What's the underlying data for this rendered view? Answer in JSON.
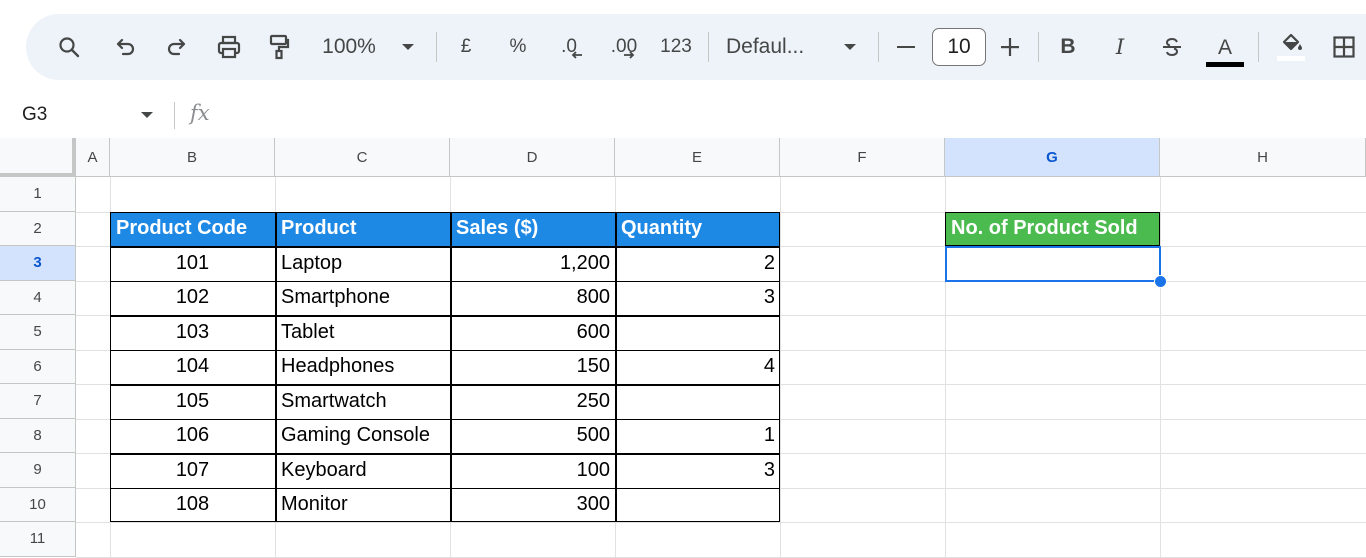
{
  "toolbar": {
    "zoom": "100%",
    "currency": "£",
    "percent": "%",
    "format_123": "123",
    "font": "Defaul...",
    "font_size": "10",
    "decrease_decimal": ".0",
    "increase_decimal": ".00",
    "bold": "B",
    "italic": "I",
    "text_color_letter": "A"
  },
  "formula_bar": {
    "name_box": "G3",
    "fx_label": "fx",
    "formula_value": ""
  },
  "columns": [
    "A",
    "B",
    "C",
    "D",
    "E",
    "F",
    "G",
    "H"
  ],
  "rows": [
    "1",
    "2",
    "3",
    "4",
    "5",
    "6",
    "7",
    "8",
    "9",
    "10",
    "11"
  ],
  "selected_cell": {
    "column": "G",
    "row": "3"
  },
  "table": {
    "headers": [
      "Product Code",
      "Product",
      "Sales ($)",
      "Quantity"
    ],
    "rows": [
      [
        "101",
        "Laptop",
        "1,200",
        "2"
      ],
      [
        "102",
        "Smartphone",
        "800",
        "3"
      ],
      [
        "103",
        "Tablet",
        "600",
        ""
      ],
      [
        "104",
        "Headphones",
        "150",
        "4"
      ],
      [
        "105",
        "Smartwatch",
        "250",
        ""
      ],
      [
        "106",
        "Gaming Console",
        "500",
        "1"
      ],
      [
        "107",
        "Keyboard",
        "100",
        "3"
      ],
      [
        "108",
        "Monitor",
        "300",
        ""
      ]
    ]
  },
  "result": {
    "header": "No. of Product Sold",
    "value": ""
  },
  "colors": {
    "table_header": "#1e88e5",
    "result_header": "#4cbb4f",
    "selection": "#1a73e8",
    "toolbar_bg": "#eef2f9"
  }
}
